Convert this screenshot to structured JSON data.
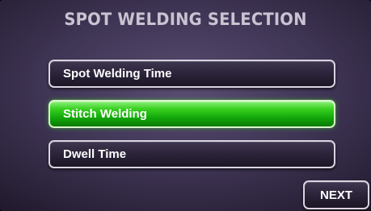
{
  "screen": {
    "title": "SPOT WELDING SELECTION"
  },
  "menu": {
    "items": [
      {
        "label": "Spot Welding Time",
        "selected": false
      },
      {
        "label": "Stitch Welding",
        "selected": true
      },
      {
        "label": "Dwell Time",
        "selected": false
      }
    ]
  },
  "navigation": {
    "next_label": "NEXT"
  },
  "colors": {
    "selected_accent": "#2ecc1a",
    "button_fill": "#2a2237",
    "background": "#3d3352"
  }
}
